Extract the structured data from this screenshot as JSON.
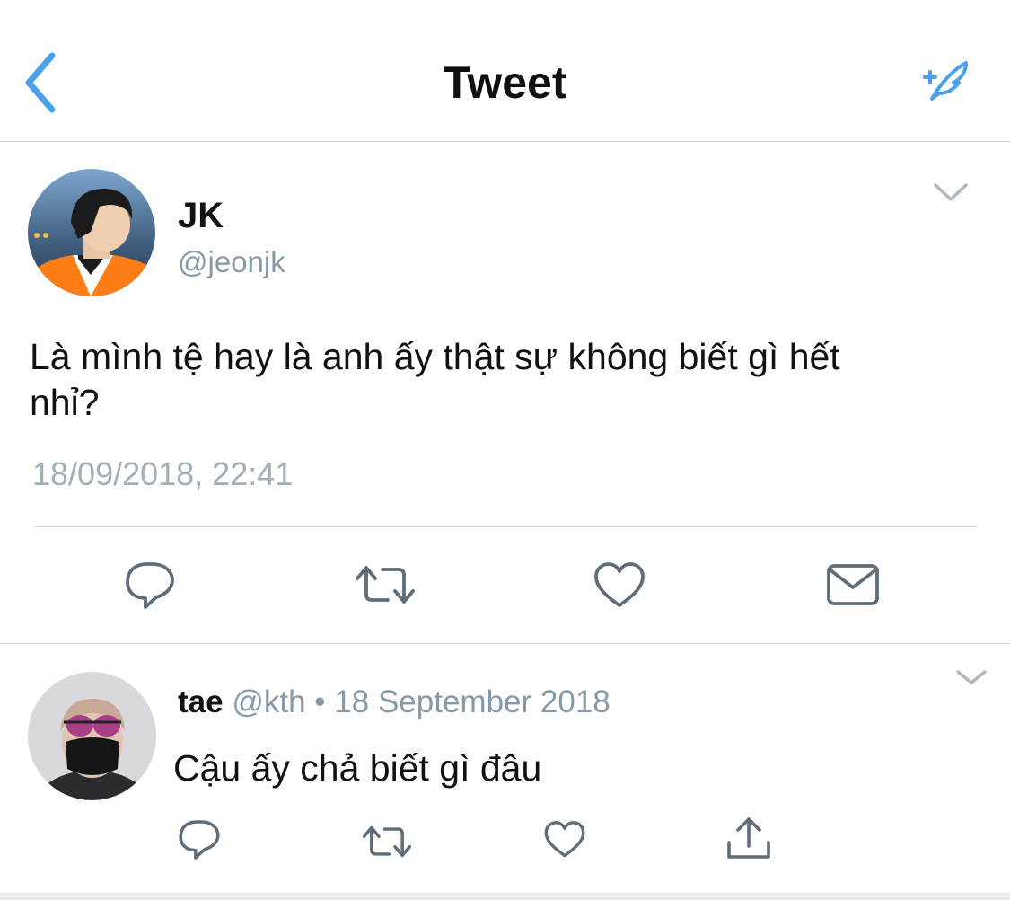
{
  "header": {
    "title": "Tweet",
    "back_icon": "chevron-left-icon",
    "compose_icon": "compose-tweet-icon",
    "accent_color": "#4aa1eb"
  },
  "tweet": {
    "name": "JK",
    "handle": "@jeonjk",
    "text": "Là mình tệ hay là anh ấy thật sự không biết gì hết nhỉ?",
    "timestamp": "18/09/2018, 22:41",
    "actions": [
      "reply-icon",
      "retweet-icon",
      "like-icon",
      "direct-message-icon"
    ]
  },
  "reply": {
    "name": "tae",
    "handle": "@kth",
    "separator": "•",
    "date": "18 September 2018",
    "text": "Cậu ấy chả biết gì đâu",
    "actions": [
      "reply-icon",
      "retweet-icon",
      "like-icon",
      "share-icon"
    ]
  }
}
